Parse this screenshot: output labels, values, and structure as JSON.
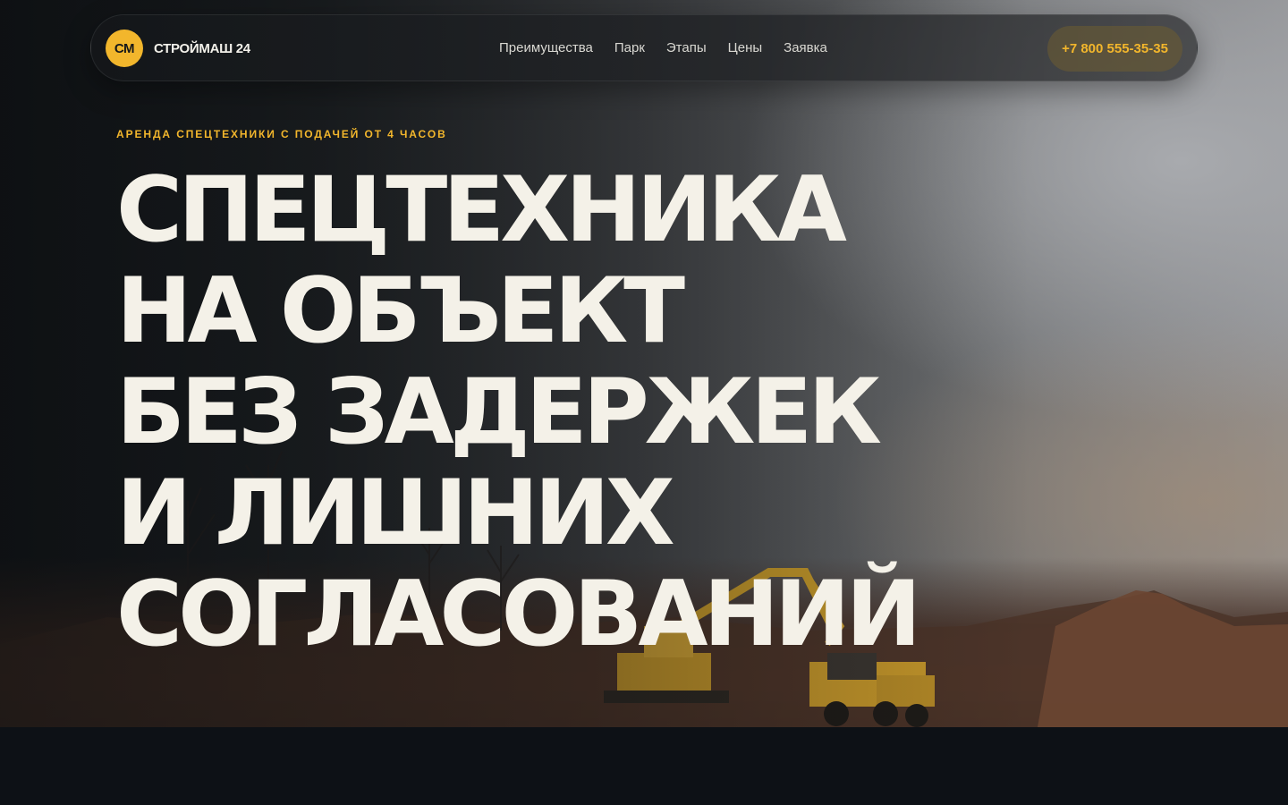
{
  "brand": {
    "badge": "СМ",
    "name": "СТРОЙМАШ 24",
    "accent_color": "#f2b62c"
  },
  "nav": {
    "links": [
      "Преимущества",
      "Парк",
      "Этапы",
      "Цены",
      "Заявка"
    ],
    "phone": "+7 800 555-35-35"
  },
  "hero": {
    "kicker": "АРЕНДА СПЕЦТЕХНИКИ С ПОДАЧЕЙ ОТ 4 ЧАСОВ",
    "headline_lines": [
      "СПЕЦТЕХНИКА",
      "НА ОБЪЕКТ",
      "БЕЗ ЗАДЕРЖЕК",
      "И ЛИШНИХ",
      "СОГЛАСОВАНИЙ"
    ],
    "text_color": "#f4f1e8"
  },
  "icons": {
    "background": "construction-site-photo",
    "excavator": "excavator-icon",
    "dump_truck": "dump-truck-icon"
  }
}
